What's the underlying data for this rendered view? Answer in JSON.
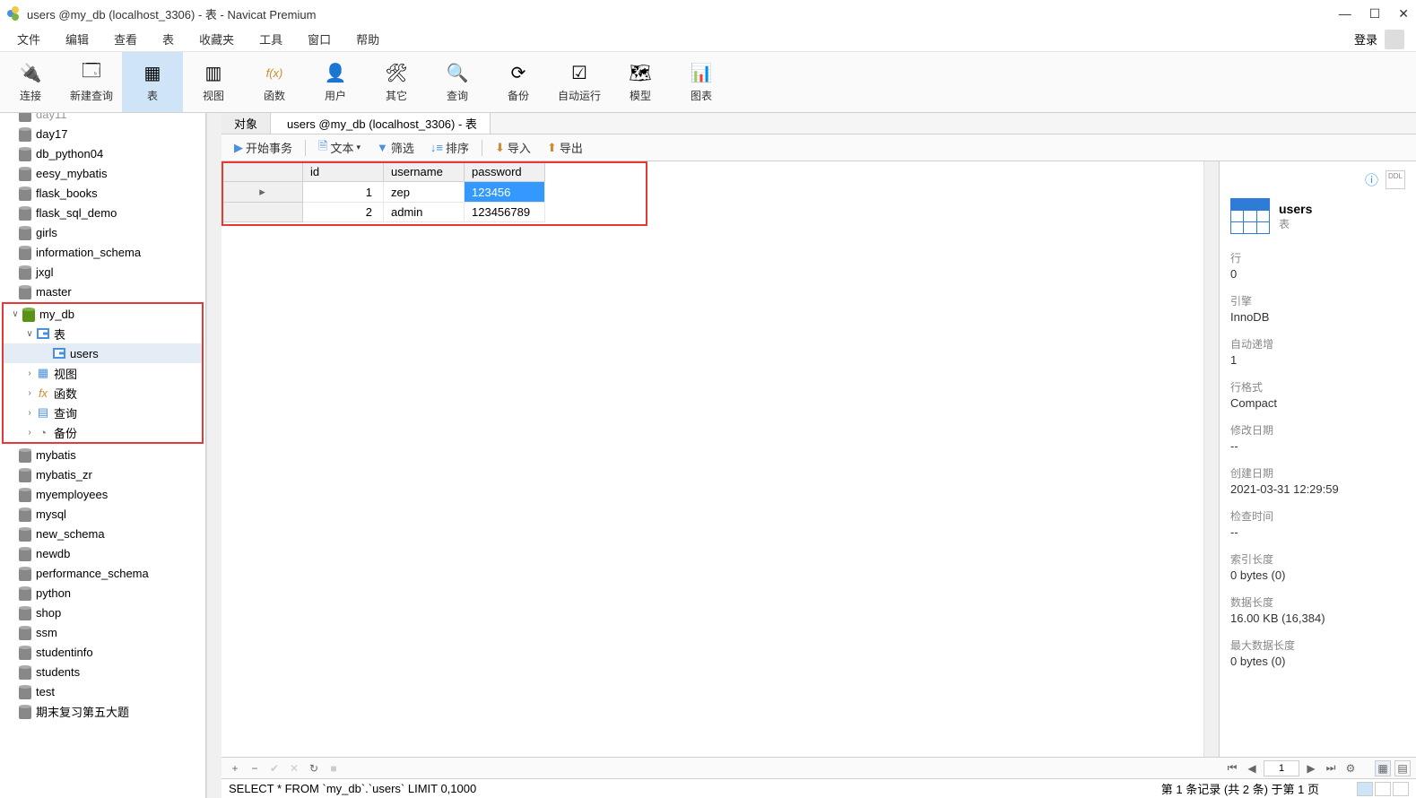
{
  "window": {
    "title": "users @my_db (localhost_3306) - 表 - Navicat Premium"
  },
  "menu": {
    "items": [
      "文件",
      "编辑",
      "查看",
      "表",
      "收藏夹",
      "工具",
      "窗口",
      "帮助"
    ],
    "login": "登录"
  },
  "toolbar": {
    "items": [
      {
        "label": "连接",
        "icon": "plug"
      },
      {
        "label": "新建查询",
        "icon": "query"
      },
      {
        "label": "表",
        "icon": "table",
        "active": true
      },
      {
        "label": "视图",
        "icon": "view"
      },
      {
        "label": "函数",
        "icon": "fx"
      },
      {
        "label": "用户",
        "icon": "user"
      },
      {
        "label": "其它",
        "icon": "other"
      },
      {
        "label": "查询",
        "icon": "search"
      },
      {
        "label": "备份",
        "icon": "backup"
      },
      {
        "label": "自动运行",
        "icon": "auto"
      },
      {
        "label": "模型",
        "icon": "model"
      },
      {
        "label": "图表",
        "icon": "chart"
      }
    ]
  },
  "tree": {
    "itemsTop": [
      "day17",
      "db_python04",
      "eesy_mybatis",
      "flask_books",
      "flask_sql_demo",
      "girls",
      "information_schema",
      "jxgl",
      "master"
    ],
    "myDb": {
      "name": "my_db",
      "table_label": "表",
      "table": "users",
      "children": [
        "视图",
        "函数",
        "查询",
        "备份"
      ]
    },
    "itemsBottom": [
      "mybatis",
      "mybatis_zr",
      "myemployees",
      "mysql",
      "new_schema",
      "newdb",
      "performance_schema",
      "python",
      "shop",
      "ssm",
      "studentinfo",
      "students",
      "test",
      "期末复习第五大题"
    ]
  },
  "tabs": {
    "obj": "对象",
    "current": "users @my_db (localhost_3306) - 表"
  },
  "subtoolbar": {
    "begin": "开始事务",
    "text": "文本",
    "filter": "筛选",
    "sort": "排序",
    "import": "导入",
    "export": "导出"
  },
  "grid": {
    "cols": [
      "id",
      "username",
      "password"
    ],
    "rows": [
      {
        "id": "1",
        "username": "zep",
        "password": "123456"
      },
      {
        "id": "2",
        "username": "admin",
        "password": "123456789"
      }
    ]
  },
  "info": {
    "title": "users",
    "sub": "表",
    "blocks": [
      {
        "lbl": "行",
        "val": "0"
      },
      {
        "lbl": "引擎",
        "val": "InnoDB"
      },
      {
        "lbl": "自动递增",
        "val": "1"
      },
      {
        "lbl": "行格式",
        "val": "Compact"
      },
      {
        "lbl": "修改日期",
        "val": "--"
      },
      {
        "lbl": "创建日期",
        "val": "2021-03-31 12:29:59"
      },
      {
        "lbl": "检查时间",
        "val": "--"
      },
      {
        "lbl": "索引长度",
        "val": "0 bytes (0)"
      },
      {
        "lbl": "数据长度",
        "val": "16.00 KB (16,384)"
      },
      {
        "lbl": "最大数据长度",
        "val": "0 bytes (0)"
      }
    ]
  },
  "pager": {
    "page": "1"
  },
  "status": {
    "sql": "SELECT * FROM `my_db`.`users` LIMIT 0,1000",
    "summary": "第 1 条记录  (共 2 条)  于第 1 页"
  }
}
